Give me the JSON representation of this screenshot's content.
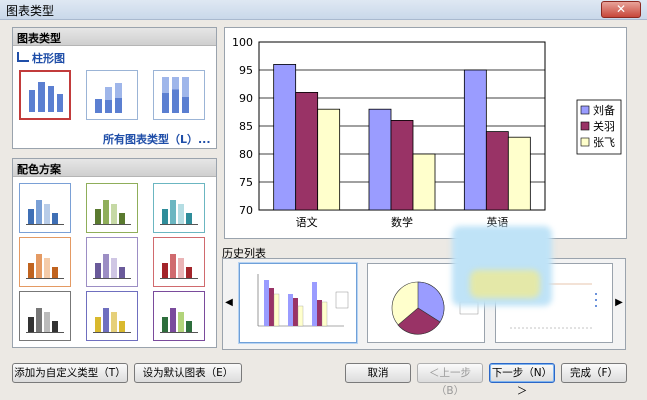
{
  "window": {
    "title": "图表类型",
    "close_label": "✕"
  },
  "chart_type_panel": {
    "header": "图表类型",
    "subtype_label": "柱形图",
    "all_types_link": "所有图表类型（L）..."
  },
  "color_scheme_panel": {
    "header": "配色方案"
  },
  "history": {
    "label": "历史列表"
  },
  "buttons": {
    "add_custom": "添加为自定义类型（T）",
    "set_default": "设为默认图表（E）",
    "cancel": "取消",
    "prev": "＜上一步（B）",
    "next": "下一步（N）＞",
    "finish": "完成（F）"
  },
  "colors": {
    "series1": "#9a9cff",
    "series2": "#993366",
    "series3": "#ffffcc",
    "accent": "#1f4ea8",
    "selected_border": "#c23b3b"
  },
  "chart_data": {
    "type": "bar",
    "categories": [
      "语文",
      "数学",
      "英语"
    ],
    "series": [
      {
        "name": "刘备",
        "values": [
          96,
          88,
          95
        ],
        "color": "#9a9cff"
      },
      {
        "name": "关羽",
        "values": [
          91,
          86,
          84
        ],
        "color": "#993366"
      },
      {
        "name": "张飞",
        "values": [
          88,
          80,
          83
        ],
        "color": "#ffffcc"
      }
    ],
    "yticks": [
      "100",
      "95",
      "90",
      "85",
      "80",
      "75",
      "70"
    ],
    "ylim": [
      70,
      100
    ],
    "grid": true,
    "legend": "right"
  }
}
